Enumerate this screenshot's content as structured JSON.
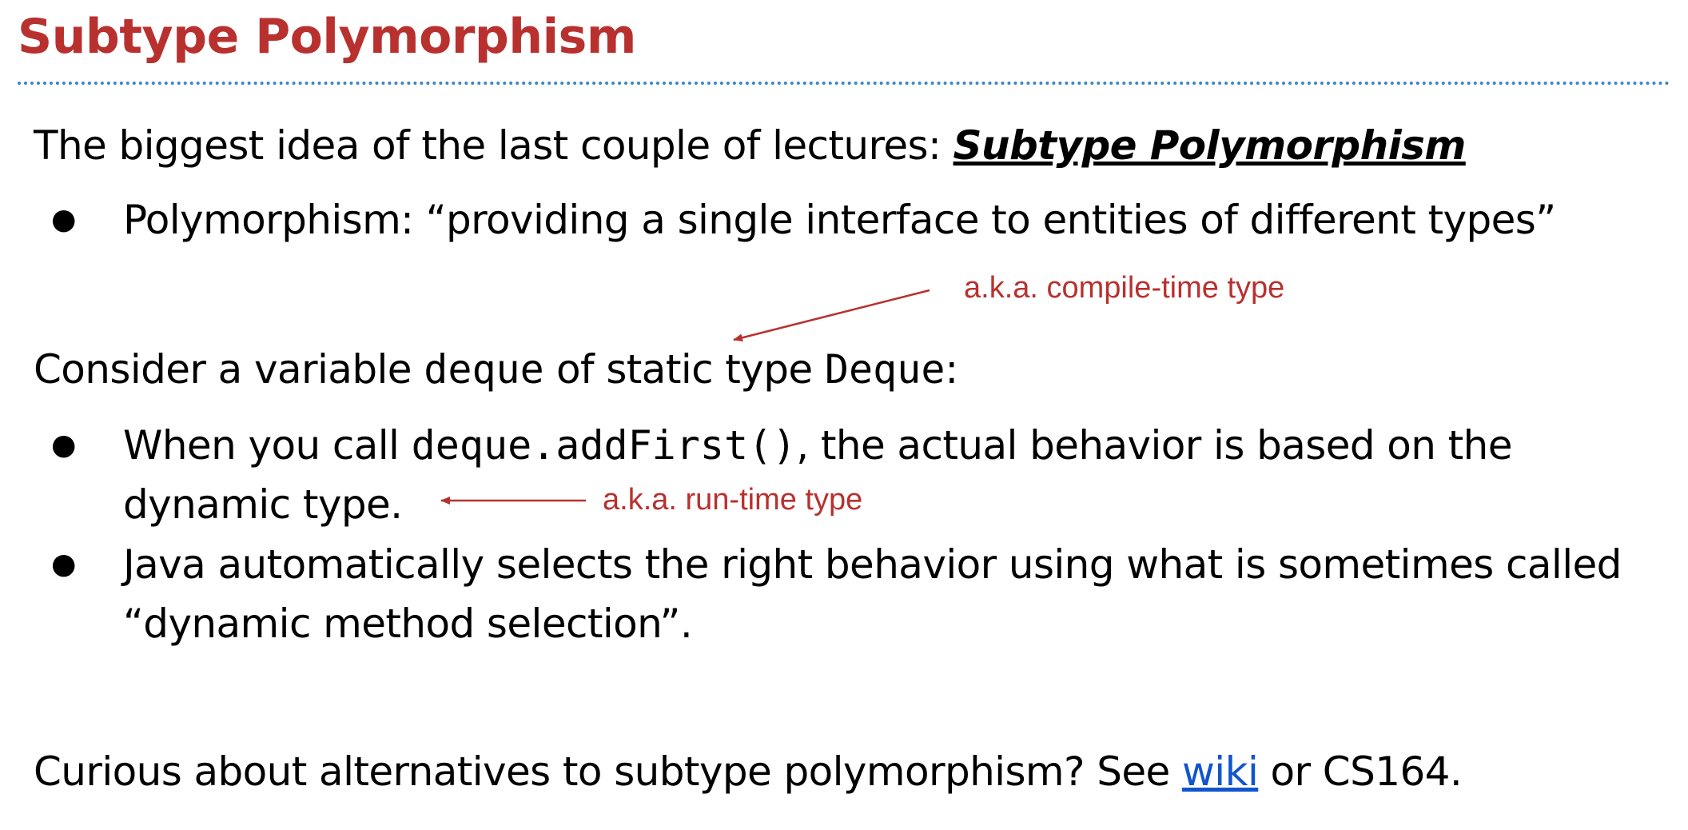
{
  "slide": {
    "title": "Subtype Polymorphism",
    "intro": {
      "prefix": "The biggest idea of the last couple of lectures: ",
      "emphasis": "Subtype Polymorphism"
    },
    "bullet_1": "Polymorphism: “providing a single interface to entities of different types”",
    "annotation_compile": "a.k.a. compile-time type",
    "consider": {
      "part1": "Consider a variable ",
      "code1": "deque",
      "part2": " of static type ",
      "code2": "Deque",
      "part3": ":"
    },
    "bullet_2": {
      "part1": "When you call ",
      "code": "deque.addFirst()",
      "part2": ", the actual behavior is based on the",
      "line2": "dynamic type."
    },
    "annotation_runtime": "a.k.a. run-time type",
    "bullet_3": {
      "line1": "Java automatically selects the right behavior using what is sometimes called",
      "line2": "“dynamic method selection”."
    },
    "footer": {
      "prefix": "Curious about alternatives to subtype polymorphism? See ",
      "link": "wiki",
      "suffix": " or CS164."
    },
    "bullet_glyph": "●"
  },
  "colors": {
    "title": "#b8312f",
    "annotation": "#b8312f",
    "rule": "#3d85c6",
    "link": "#1155cc"
  }
}
